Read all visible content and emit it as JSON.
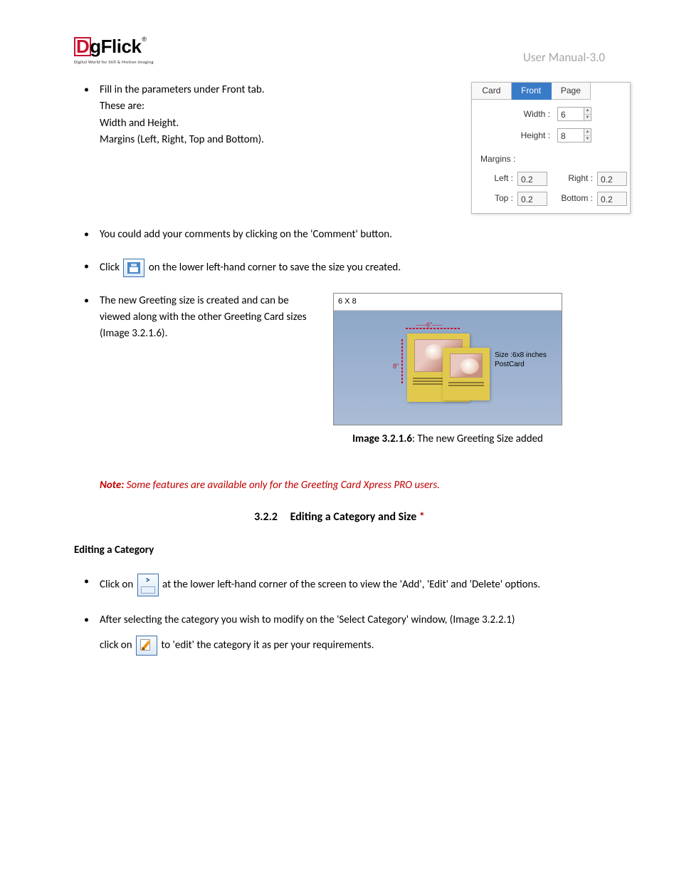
{
  "header": {
    "brand": "DgFlick",
    "tagline": "Digital World for Still & Motion Imaging",
    "reg": "®",
    "doc_title": "User Manual-3.0"
  },
  "bullet1": {
    "line1": "Fill in the parameters under Front tab.",
    "line2": "These are:",
    "line3": "Width and Height.",
    "line4": "Margins (Left, Right, Top and Bottom)."
  },
  "dialog": {
    "tabs": {
      "card": "Card",
      "front": "Front",
      "page": "Page"
    },
    "width_label": "Width :",
    "width_value": "6",
    "height_label": "Height :",
    "height_value": "8",
    "margins_label": "Margins :",
    "left_label": "Left :",
    "left_value": "0.2",
    "right_label": "Right :",
    "right_value": "0.2",
    "top_label": "Top :",
    "top_value": "0.2",
    "bottom_label": "Bottom :",
    "bottom_value": "0.2"
  },
  "bullet2": "You could add your comments by clicking on the 'Comment' button.",
  "bullet3": {
    "pre": "Click",
    "post": " on the lower left-hand corner to save the size you created."
  },
  "bullet4": "The new Greeting size is created and can be viewed along with the other Greeting Card sizes (Image 3.2.1.6).",
  "preview": {
    "title": "6 X 8",
    "dim_w": "-----6\"-----",
    "dim_h": "8\"",
    "size_line1": "Size :6x8 inches",
    "size_line2": "PostCard"
  },
  "caption": {
    "bold": "Image 3.2.1.6",
    "rest": ": The new Greeting Size added"
  },
  "note": {
    "label": "Note:",
    "text": " Some features are available only for the Greeting Card Xpress PRO users."
  },
  "section": {
    "num": "3.2.2",
    "title": "Editing a Category and Size ",
    "star": "*"
  },
  "subsection": "Editing a Category",
  "bullet5": {
    "pre": "Click on ",
    "post": " at the lower left-hand corner of the screen to view the 'Add', 'Edit' and 'Delete' options."
  },
  "bullet6": {
    "line1": "After selecting the category you wish to modify on the 'Select Category' window, (Image 3.2.2.1)",
    "line2_pre": "click on ",
    "line2_post": " to 'edit' the category it as per your requirements."
  }
}
